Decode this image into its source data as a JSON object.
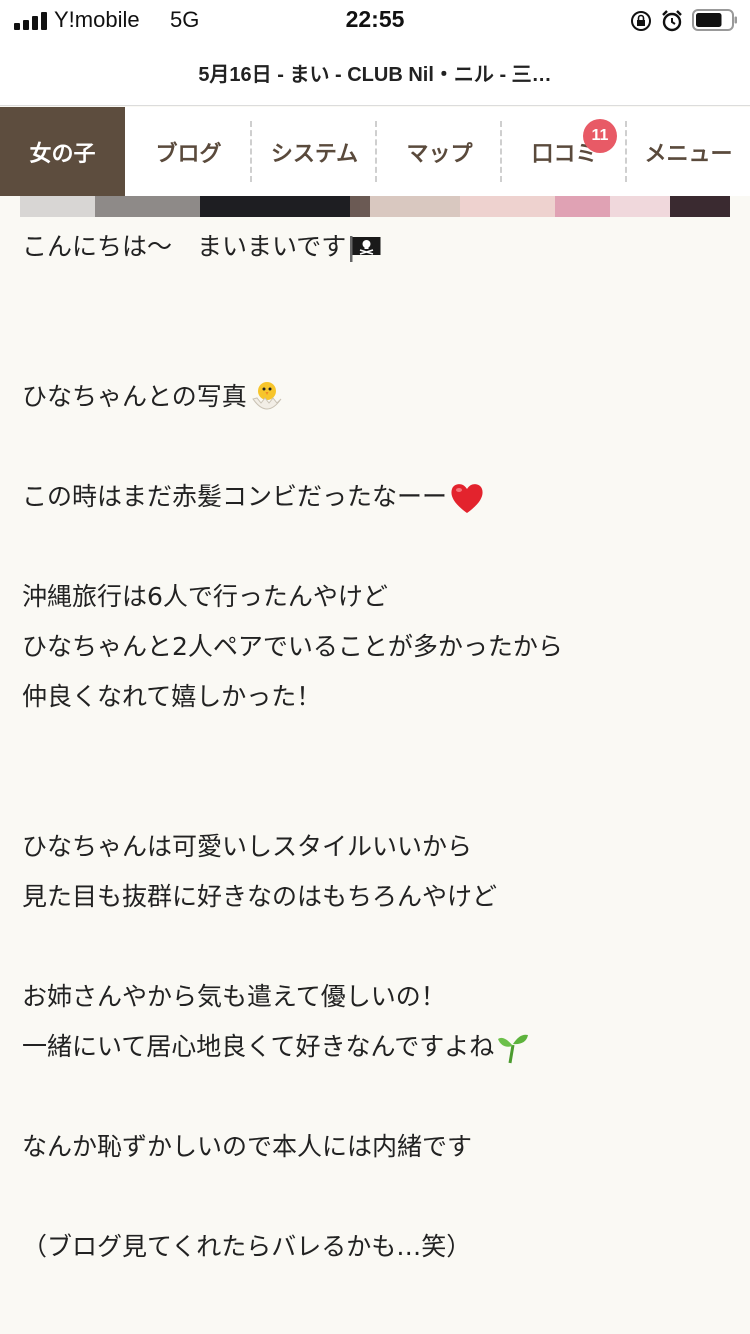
{
  "status_bar": {
    "carrier": "Y!mobile",
    "network": "5G",
    "time": "22:55",
    "icons": [
      "signal-icon",
      "rotation-lock-icon",
      "alarm-icon",
      "battery-icon"
    ],
    "battery_level": 0.75
  },
  "header": {
    "title": "5月16日 - まい - CLUB Nil・ニル - 三…"
  },
  "nav": {
    "tabs": [
      {
        "label": "女の子",
        "active": true
      },
      {
        "label": "ブログ",
        "active": false
      },
      {
        "label": "システム",
        "active": false
      },
      {
        "label": "マップ",
        "active": false
      },
      {
        "label": "口コミ",
        "active": false,
        "badge": "11"
      },
      {
        "label": "メニュー",
        "active": false
      }
    ]
  },
  "article": {
    "lines": [
      "こんにちは〜　まいまいです",
      "",
      "",
      "ひなちゃんとの写真",
      "",
      "この時はまだ赤髪コンビだったなーー",
      "",
      "沖縄旅行は6人で行ったんやけど",
      "ひなちゃんと2人ペアでいることが多かったから",
      "仲良くなれて嬉しかった！",
      "",
      "",
      "ひなちゃんは可愛いしスタイルいいから",
      "見た目も抜群に好きなのはもちろんやけど",
      "",
      "お姉さんやから気も遣えて優しいの！",
      "一緒にいて居心地良くて好きなんですよね",
      "",
      "なんか恥ずかしいので本人には内緒です",
      "",
      "（ブログ見てくれたらバレるかも…笑）"
    ],
    "emojis": {
      "line0": "pirate-flag-icon",
      "line3": "hatching-chick-icon",
      "line5": "red-heart-icon",
      "line16": "seedling-icon"
    }
  },
  "colors": {
    "active_tab_bg": "#5d4d3e",
    "tab_text": "#5a4a3c",
    "badge": "#e85a66",
    "page_bg": "#faf9f4"
  }
}
